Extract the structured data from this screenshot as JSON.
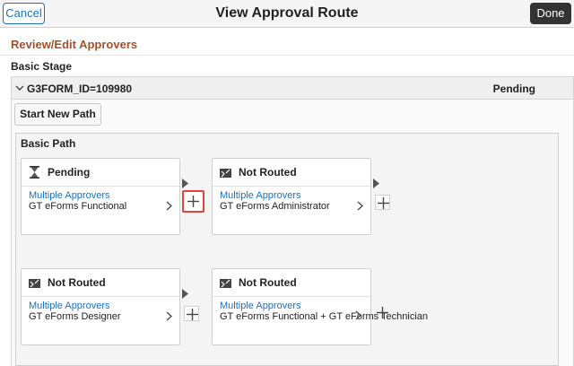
{
  "header": {
    "cancel_label": "Cancel",
    "title": "View Approval Route",
    "done_label": "Done"
  },
  "section_title": "Review/Edit Approvers",
  "stage": {
    "label": "Basic Stage",
    "id": "G3FORM_ID=109980",
    "status": "Pending",
    "start_new_path_label": "Start New Path"
  },
  "path": {
    "label": "Basic Path",
    "steps": [
      {
        "status": "Pending",
        "icon": "hourglass-icon",
        "link": "Multiple Approvers",
        "role": "GT eForms Functional"
      },
      {
        "status": "Not Routed",
        "icon": "not-routed-icon",
        "link": "Multiple Approvers",
        "role": "GT eForms Administrator"
      },
      {
        "status": "Not Routed",
        "icon": "not-routed-icon",
        "link": "Multiple Approvers",
        "role": "GT eForms Designer"
      },
      {
        "status": "Not Routed",
        "icon": "not-routed-icon",
        "link": "Multiple Approvers",
        "role": "GT eForms Functional + GT eForms Technician"
      }
    ]
  },
  "colors": {
    "link": "#1f6fb2",
    "section_title": "#a0522d",
    "highlight": "#e0443e",
    "done_bg": "#333333"
  }
}
